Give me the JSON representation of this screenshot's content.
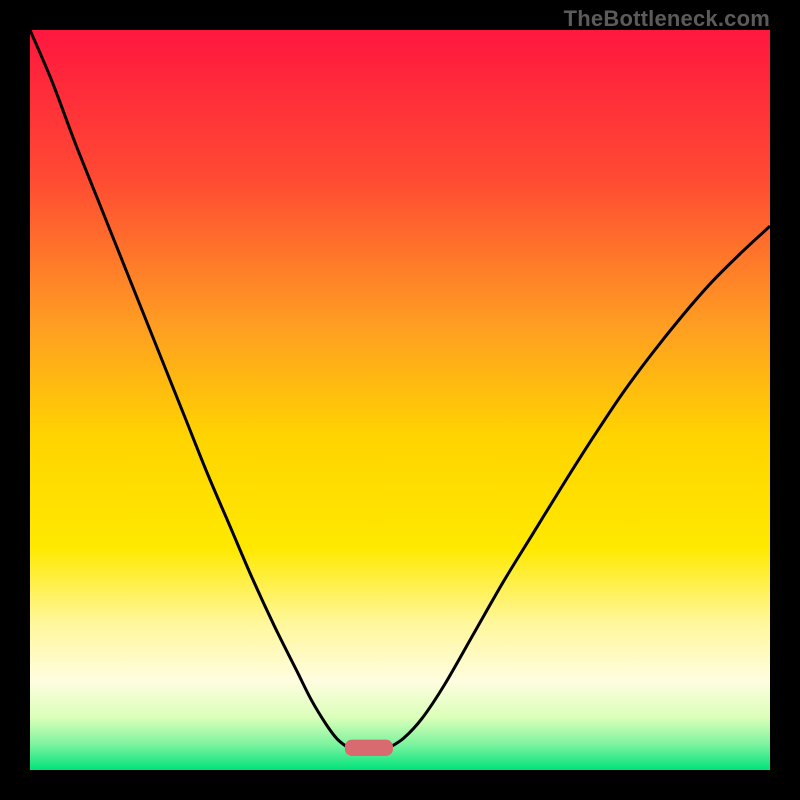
{
  "watermark": "TheBottleneck.com",
  "chart_data": {
    "type": "line",
    "title": "",
    "xlabel": "",
    "ylabel": "",
    "xlim": [
      0,
      100
    ],
    "ylim": [
      0,
      100
    ],
    "gradient_stops": [
      {
        "offset": 0.0,
        "color": "#ff173f"
      },
      {
        "offset": 0.2,
        "color": "#ff4a33"
      },
      {
        "offset": 0.4,
        "color": "#ff9e22"
      },
      {
        "offset": 0.55,
        "color": "#ffd400"
      },
      {
        "offset": 0.7,
        "color": "#ffe900"
      },
      {
        "offset": 0.8,
        "color": "#fff79a"
      },
      {
        "offset": 0.88,
        "color": "#fffde0"
      },
      {
        "offset": 0.93,
        "color": "#d9ffb8"
      },
      {
        "offset": 0.965,
        "color": "#7ef3a0"
      },
      {
        "offset": 1.0,
        "color": "#00e37a"
      }
    ],
    "series": [
      {
        "name": "left-curve",
        "x": [
          0.0,
          3.0,
          6.0,
          9.0,
          12.0,
          15.0,
          18.0,
          21.0,
          24.0,
          27.0,
          30.0,
          33.0,
          36.0,
          38.0,
          40.0,
          41.5,
          43.0
        ],
        "values": [
          100.0,
          93.0,
          85.0,
          77.5,
          70.0,
          62.5,
          55.0,
          47.5,
          40.0,
          33.0,
          26.0,
          19.5,
          13.5,
          9.5,
          6.2,
          4.2,
          3.0
        ]
      },
      {
        "name": "right-curve",
        "x": [
          48.5,
          50.5,
          53.0,
          56.0,
          60.0,
          64.0,
          68.0,
          72.0,
          76.0,
          80.0,
          84.0,
          88.0,
          92.0,
          96.0,
          100.0
        ],
        "values": [
          3.0,
          4.3,
          7.0,
          11.5,
          18.5,
          25.5,
          32.0,
          38.5,
          44.8,
          50.8,
          56.2,
          61.2,
          65.8,
          69.8,
          73.5
        ]
      }
    ],
    "marker": {
      "name": "bottom-marker",
      "x_center": 45.8,
      "y_center": 3.0,
      "width": 6.5,
      "height": 2.2,
      "color": "#d96a6f"
    }
  }
}
